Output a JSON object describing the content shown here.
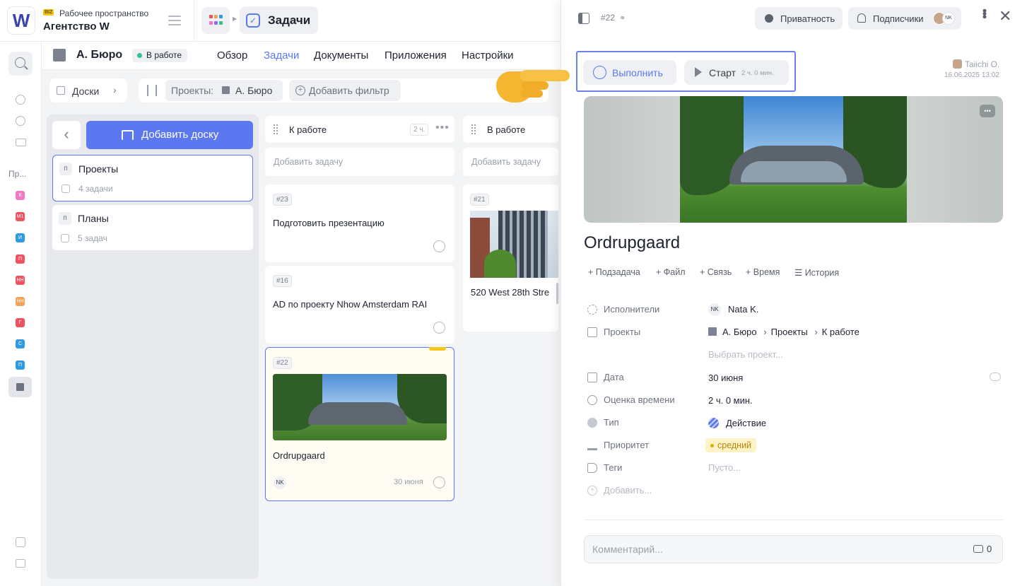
{
  "workspace": {
    "badge": "BIZ",
    "label": "Рабочее пространство",
    "name": "Агентство W",
    "logo": "W"
  },
  "app": {
    "tab_title": "Задачи"
  },
  "project": {
    "name": "А. Бюро",
    "status": "В работе"
  },
  "tabs": [
    "Обзор",
    "Задачи",
    "Документы",
    "Приложения",
    "Настройки"
  ],
  "filters": {
    "boards": "Доски",
    "projects_label": "Проекты:",
    "project_value": "А. Бюро",
    "add_filter": "Добавить фильтр"
  },
  "rail": {
    "section": "Пр...",
    "items": [
      {
        "label": "К",
        "color": "#f07ac7"
      },
      {
        "label": "М1",
        "color": "#f0525f"
      },
      {
        "label": "И",
        "color": "#2f9be3"
      },
      {
        "label": "П",
        "color": "#f0525f"
      },
      {
        "label": "НН",
        "color": "#f0525f"
      },
      {
        "label": "НН",
        "color": "#f5a259"
      },
      {
        "label": "Г",
        "color": "#f0525f"
      },
      {
        "label": "С",
        "color": "#2f9be3"
      },
      {
        "label": "П",
        "color": "#2f9be3"
      }
    ]
  },
  "boards_panel": {
    "add_board": "Добавить доску",
    "boards": [
      {
        "letter": "п",
        "name": "Проекты",
        "count": "4 задачи"
      },
      {
        "letter": "п",
        "name": "Планы",
        "count": "5 задач"
      }
    ]
  },
  "columns": [
    {
      "title": "К работе",
      "meta": "2 ч.",
      "add": "Добавить задачу"
    },
    {
      "title": "В работе",
      "add": "Добавить задачу"
    }
  ],
  "cards": [
    {
      "id": "#23",
      "title": "Подготовить презентацию"
    },
    {
      "id": "#16",
      "title": "AD по проекту Nhow Amsterdam RAI"
    },
    {
      "id": "#22",
      "title": "Ordrupgaard",
      "assignee": "NK",
      "date": "30 июня"
    },
    {
      "id": "#21",
      "title": "520 West 28th Stre"
    }
  ],
  "task": {
    "id": "#22",
    "privacy": "Приватность",
    "subscribers": "Подписчики",
    "subscriber_initials": "NK",
    "complete": "Выполнить",
    "start": "Старт",
    "start_time": "2 ч. 0 мин.",
    "author": "Taiichi O.",
    "created": "16.06.2025 13:02",
    "title": "Ordrupgaard",
    "actions": [
      "Подзадача",
      "Файл",
      "Связь",
      "Время",
      "История"
    ],
    "props": {
      "assignees_label": "Исполнители",
      "assignee_initials": "NK",
      "assignee": "Nata K.",
      "projects_label": "Проекты",
      "project": "А. Бюро",
      "board": "Проекты",
      "column": "К работе",
      "choose_project": "Выбрать проект...",
      "date_label": "Дата",
      "date": "30 июня",
      "estimate_label": "Оценка времени",
      "estimate": "2 ч. 0 мин.",
      "type_label": "Тип",
      "type": "Действие",
      "priority_label": "Приоритет",
      "priority": "средний",
      "priority_color": "#f5c518",
      "tags_label": "Теги",
      "tags": "Пусто...",
      "add_label": "Добавить..."
    },
    "comment_placeholder": "Комментарий...",
    "comment_count": "0"
  },
  "colors": {
    "accent": "#5b78f0",
    "highlight_border": "#6b7ff0"
  }
}
